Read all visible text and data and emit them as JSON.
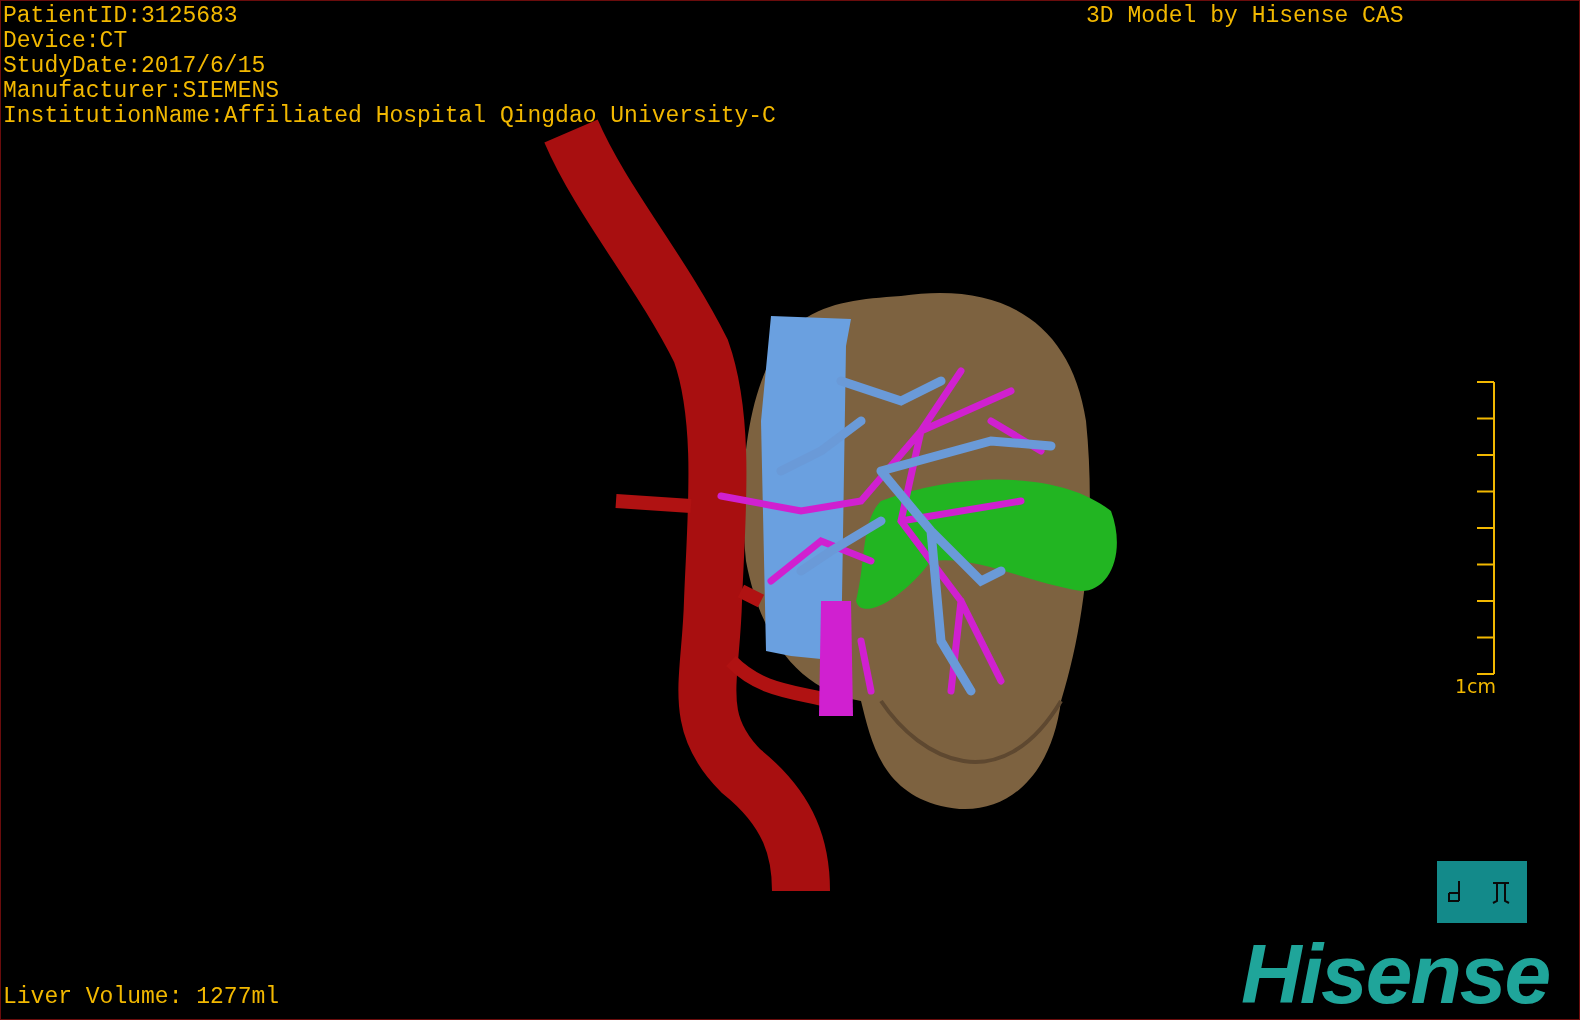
{
  "info_lines": [
    "PatientID:3125683",
    "Device:CT",
    "StudyDate:2017/6/15",
    "Manufacturer:SIEMENS",
    "InstitutionName:Affiliated Hospital Qingdao University-C"
  ],
  "title": "3D Model by Hisense CAS",
  "scale_bar": {
    "label": "1cm"
  },
  "measurement": "Liver Volume: 1277ml",
  "logo": "Hisense"
}
